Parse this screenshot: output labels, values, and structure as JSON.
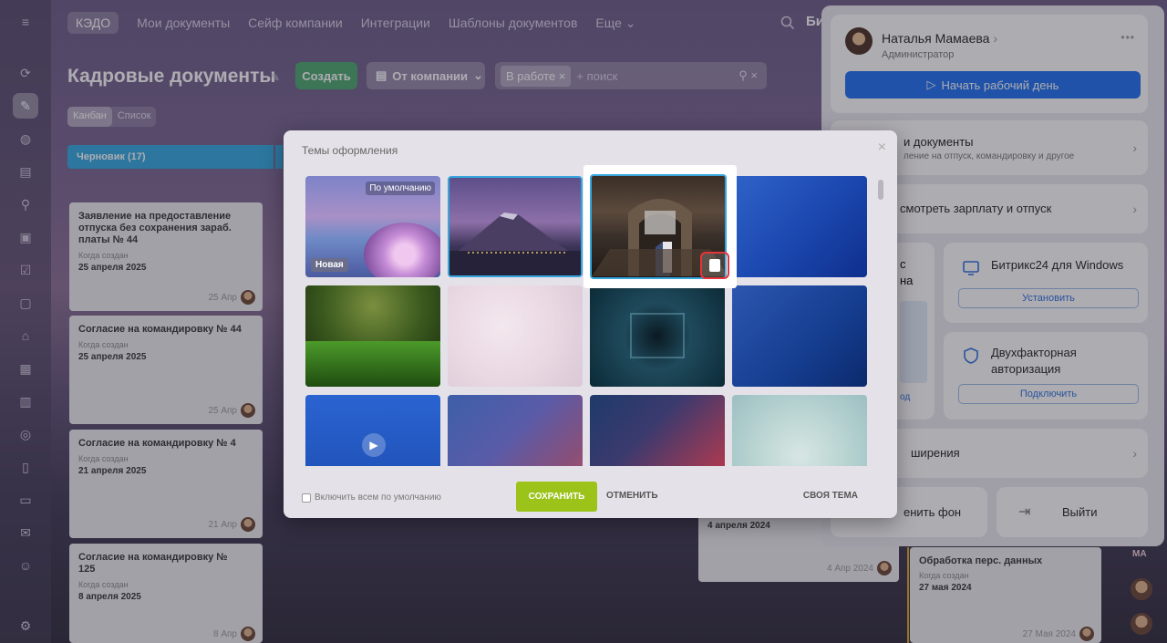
{
  "topnav": {
    "items": [
      "КЭДО",
      "Мои документы",
      "Сейф компании",
      "Интеграции",
      "Шаблоны документов",
      "Еще ⌄"
    ],
    "brand_fragment": "Би"
  },
  "header": {
    "title": "Кадровые документы",
    "create_label": "Создать",
    "company_label": "От компании",
    "filter_tag": "В работе",
    "search_placeholder": "+ поиск"
  },
  "views": {
    "kanban": "Канбан",
    "list": "Список"
  },
  "kanban": {
    "column_label": "Черновик (17)",
    "cards": [
      {
        "title": "Заявление на предоставление отпуска без сохранения зараб. платы № 44",
        "created_label": "Когда создан",
        "created": "25 апреля 2025",
        "short": "25 Апр"
      },
      {
        "title": "Согласие на командировку № 44",
        "created_label": "Когда создан",
        "created": "25 апреля 2025",
        "short": "25 Апр"
      },
      {
        "title": "Согласие на командировку № 4",
        "created_label": "Когда создан",
        "created": "21 апреля 2025",
        "short": "21 Апр"
      },
      {
        "title": "Согласие на командировку № 125",
        "created_label": "Когда создан",
        "created": "8 апреля 2025",
        "short": "8 Апр"
      }
    ],
    "right_card_a": {
      "created": "4 апреля 2024",
      "short": "4 Апр 2024"
    },
    "right_card_b": {
      "title": "Обработка перс. данных",
      "created_label": "Когда создан",
      "created": "27 мая 2024",
      "short": "27 Мая 2024"
    },
    "corner_tag": "МА"
  },
  "panel": {
    "user_name": "Наталья Мамаева",
    "user_role": "Администратор",
    "start_day": "Начать рабочий день",
    "docs_title": "и документы",
    "docs_sub": "ление на отпуск, командировку и другое",
    "salary": "смотреть зарплату и отпуск",
    "left_tile_a": "с",
    "left_tile_b": "на",
    "left_tile_c": "од",
    "windows_title": "Битрикс24 для Windows",
    "windows_btn": "Установить",
    "twofa_title": "Двухфакторная авторизация",
    "twofa_btn": "Подключить",
    "extensions": "ширения",
    "change_bg": "енить фон",
    "logout": "Выйти"
  },
  "modal": {
    "title": "Темы оформления",
    "default_badge": "По умолчанию",
    "new_badge": "Новая",
    "checkbox_label": "Включить всем по умолчанию",
    "save": "СОХРАНИТЬ",
    "cancel": "ОТМЕНИТЬ",
    "own_theme": "СВОЯ ТЕМА"
  },
  "colors": {
    "accent_blue": "#1a6ef0",
    "save_green": "#9bc31a",
    "create_green": "#4aa96c",
    "column_blue": "#2fa8e2",
    "delete_red": "#e8333a"
  }
}
